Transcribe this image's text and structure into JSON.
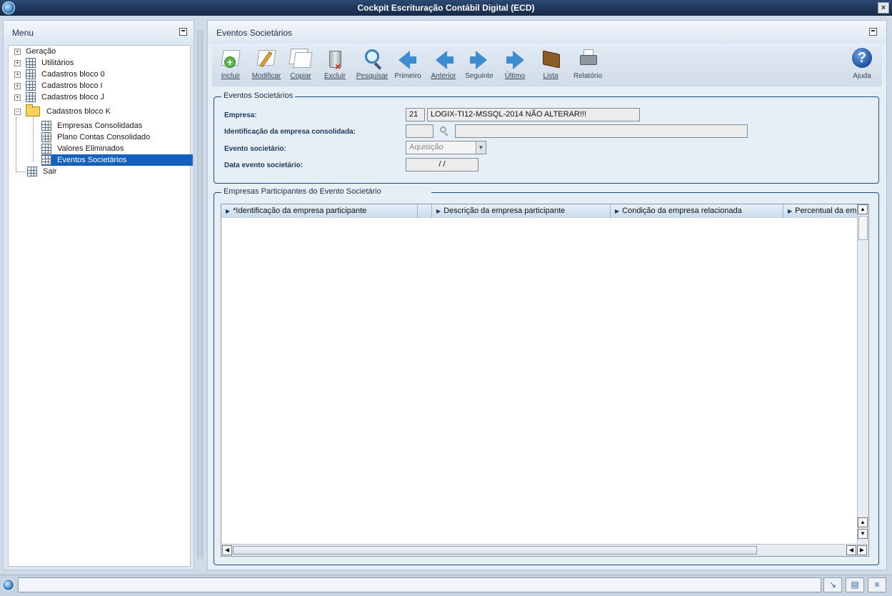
{
  "window": {
    "title": "Cockpit Escrituração Contábil Digital (ECD)",
    "close_glyph": "×"
  },
  "menu": {
    "title": "Menu",
    "items": [
      {
        "label": "Geração"
      },
      {
        "label": "Utilitários"
      },
      {
        "label": "Cadastros bloco 0"
      },
      {
        "label": "Cadastros bloco I"
      },
      {
        "label": "Cadastros bloco J"
      },
      {
        "label": "Cadastros bloco K",
        "expanded": true
      },
      {
        "label": "Empresas Consolidadas"
      },
      {
        "label": "Plano Contas Consolidado"
      },
      {
        "label": "Valores Eliminados"
      },
      {
        "label": "Eventos Societários",
        "selected": true
      },
      {
        "label": "Sair"
      }
    ]
  },
  "main": {
    "title": "Eventos Societários",
    "toolbar": [
      {
        "label": "Incluir",
        "icon": "add-document-icon"
      },
      {
        "label": "Modificar",
        "icon": "edit-document-icon"
      },
      {
        "label": "Copiar",
        "icon": "copy-document-icon"
      },
      {
        "label": "Excluir",
        "icon": "trash-icon"
      },
      {
        "label": "Pesquisar",
        "icon": "search-icon"
      },
      {
        "label": "Primeiro",
        "icon": "first-arrow-icon"
      },
      {
        "label": "Anterior",
        "icon": "previous-arrow-icon"
      },
      {
        "label": "Seguinte",
        "icon": "next-arrow-icon"
      },
      {
        "label": "Último",
        "icon": "last-arrow-icon"
      },
      {
        "label": "Lista",
        "icon": "book-icon"
      },
      {
        "label": "Relatório",
        "icon": "printer-icon"
      },
      {
        "label": "Ajuda",
        "icon": "help-icon"
      }
    ],
    "form": {
      "title": "Eventos Societários",
      "empresa_label": "Empresa:",
      "empresa_code": "21",
      "empresa_name": "LOGIX-TI12-MSSQL-2014 NÃO ALTERAR!!!",
      "identificacao_label": "Identificação da empresa consolidada:",
      "identificacao_code": "",
      "identificacao_desc": "",
      "evento_label": "Evento societário:",
      "evento_value": "Aquisição",
      "data_label": "Data evento societário:",
      "data_value": "/ /"
    },
    "participants": {
      "title": "Empresas Participantes do Evento Societário",
      "columns": [
        "*Identificação da empresa participante",
        "Descrição da empresa participante",
        "Condição da empresa relacionada",
        "Percentual da empresa"
      ]
    }
  },
  "status": {
    "text": ""
  }
}
